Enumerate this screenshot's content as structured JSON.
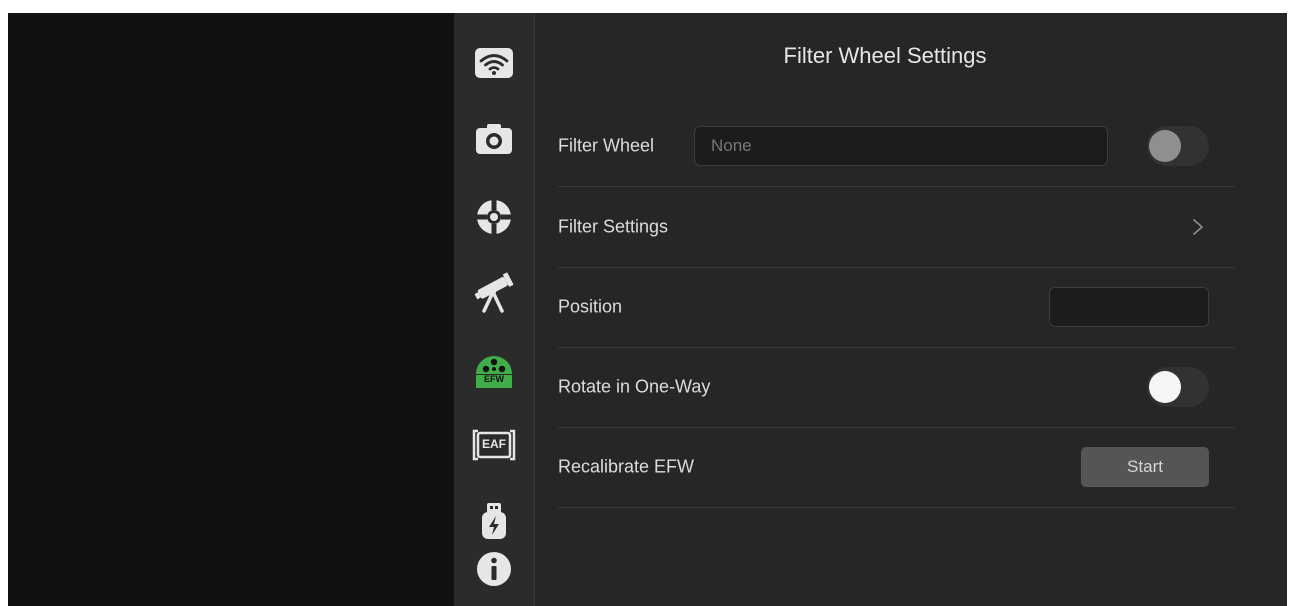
{
  "title": "Filter Wheel Settings",
  "accent_color": "#3fae49",
  "sidebar": {
    "items": [
      {
        "icon": "wifi-icon",
        "active": false
      },
      {
        "icon": "camera-icon",
        "active": false
      },
      {
        "icon": "guide-crosshair-icon",
        "active": false
      },
      {
        "icon": "telescope-icon",
        "active": false
      },
      {
        "icon": "efw-icon",
        "label": "EFW",
        "active": true
      },
      {
        "icon": "eaf-icon",
        "label": "EAF",
        "active": false
      },
      {
        "icon": "power-usb-icon",
        "active": false
      },
      {
        "icon": "info-icon",
        "active": false
      }
    ]
  },
  "filter_wheel": {
    "label": "Filter Wheel",
    "placeholder": "None",
    "value": "",
    "connected": false
  },
  "filter_settings": {
    "label": "Filter Settings",
    "icon": "chevron-right-icon"
  },
  "position": {
    "label": "Position",
    "value": ""
  },
  "rotate_one_way": {
    "label": "Rotate in One-Way",
    "enabled": false
  },
  "recalibrate": {
    "label": "Recalibrate EFW",
    "button_label": "Start"
  }
}
